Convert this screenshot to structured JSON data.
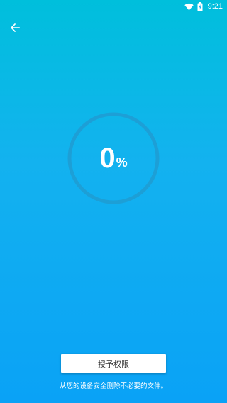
{
  "status_bar": {
    "time": "9:21",
    "icons": [
      "wifi-icon",
      "battery-charging-icon"
    ]
  },
  "header": {
    "back_icon": "arrow-left-icon"
  },
  "progress": {
    "value": "0",
    "unit": "%",
    "fraction": 0
  },
  "actions": {
    "grant_label": "授予权限"
  },
  "hint_text": "从您的设备安全删除不必要的文件。",
  "colors": {
    "gradient_top": "#00bfdc",
    "gradient_bottom": "#0aa2f6",
    "ring": "#1d9fd6"
  }
}
